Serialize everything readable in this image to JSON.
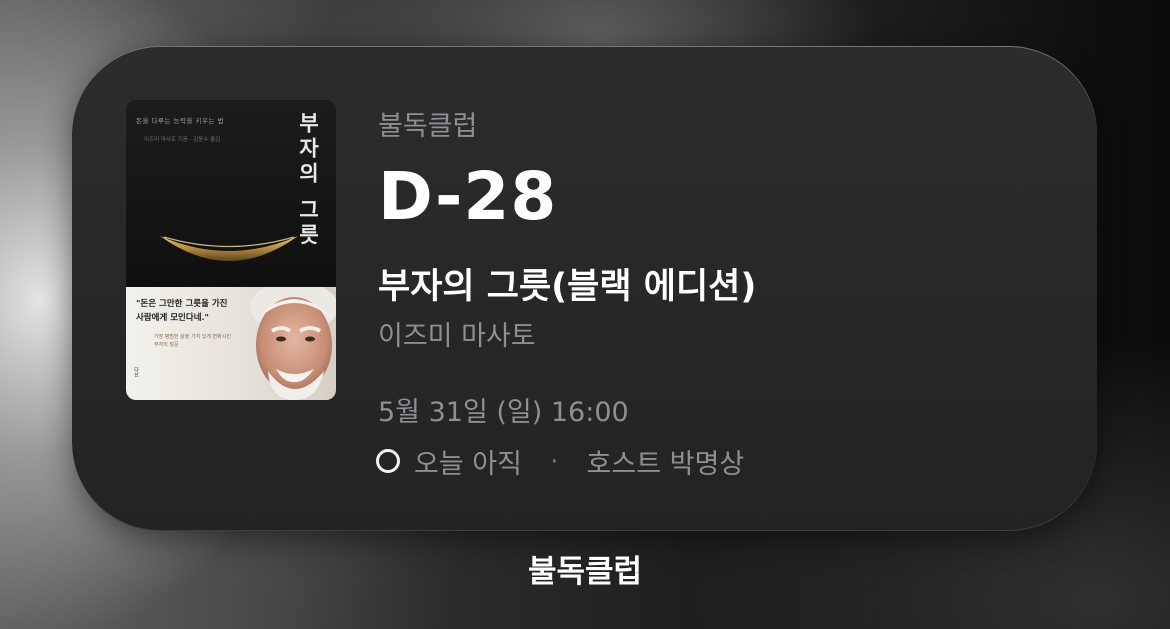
{
  "widget": {
    "club_name": "불독클럽",
    "countdown": "D-28",
    "book_title": "부자의 그릇(블랙 에디션)",
    "author": "이즈미 마사토",
    "datetime": "5월 31일 (일) 16:00",
    "status": "오늘 아직",
    "separator": "·",
    "host": "호스트 박명상"
  },
  "cover": {
    "subtitle": "돈을 다루는 능력을 키우는 법",
    "credits": "이즈미 마사토 지음 · 김윤수 옮김",
    "title": "부자의 그릇",
    "quote_line1": "\"돈은 그만한 그릇을 가진",
    "quote_line2": "사람에게 모인다네.\"",
    "small_line1": "가장 평범한 삶을 가치 있게 변화시킨",
    "small_line2": "부자의 질문",
    "publisher": "다산"
  },
  "app_label": "불독클럽"
}
